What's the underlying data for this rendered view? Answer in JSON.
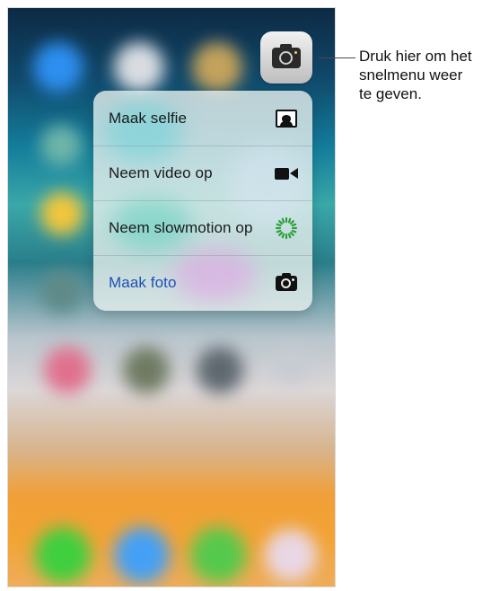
{
  "home_screen": {
    "camera_app_icon": "camera-icon"
  },
  "quick_actions_menu": {
    "items": [
      {
        "label": "Maak selfie",
        "icon": "selfie-icon",
        "color": "#1a1a1a"
      },
      {
        "label": "Neem video op",
        "icon": "video-camera-icon",
        "color": "#1a1a1a"
      },
      {
        "label": "Neem slowmotion op",
        "icon": "slowmotion-icon",
        "color": "#1a1a1a"
      },
      {
        "label": "Maak foto",
        "icon": "camera-icon",
        "color": "#1e50b4"
      }
    ]
  },
  "callout": {
    "text": "Druk hier om het\nsnelmenu weer\nte geven."
  }
}
